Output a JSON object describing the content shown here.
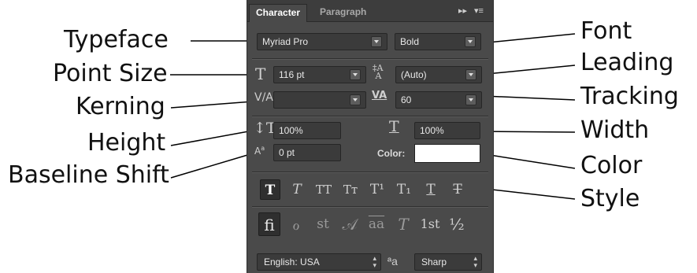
{
  "annotations": {
    "left": [
      "Typeface",
      "Point Size",
      "Kerning",
      "Height",
      "Baseline Shift"
    ],
    "right": [
      "Font",
      "Leading",
      "Tracking",
      "Width",
      "Color",
      "Style"
    ]
  },
  "panel": {
    "tabs": [
      "Character",
      "Paragraph"
    ],
    "tab_controls": [
      "▸▸",
      "▾≡"
    ],
    "font_family": "Myriad Pro",
    "font_style": "Bold",
    "size": "116 pt",
    "leading": "(Auto)",
    "kerning": "",
    "tracking": "60",
    "vertical_scale": "100%",
    "horizontal_scale": "100%",
    "baseline_shift": "0 pt",
    "color_label": "Color:",
    "color_value": "#ffffff",
    "style_buttons": [
      "T",
      "T",
      "TT",
      "Tт",
      "T¹",
      "T₁",
      "T",
      "T"
    ],
    "opentype_buttons": [
      "fi",
      "ℴ",
      "st",
      "𝒜",
      "aa",
      "T",
      "1st",
      "½"
    ],
    "language": "English: USA",
    "antialias_icon": "ªa",
    "antialias": "Sharp"
  }
}
